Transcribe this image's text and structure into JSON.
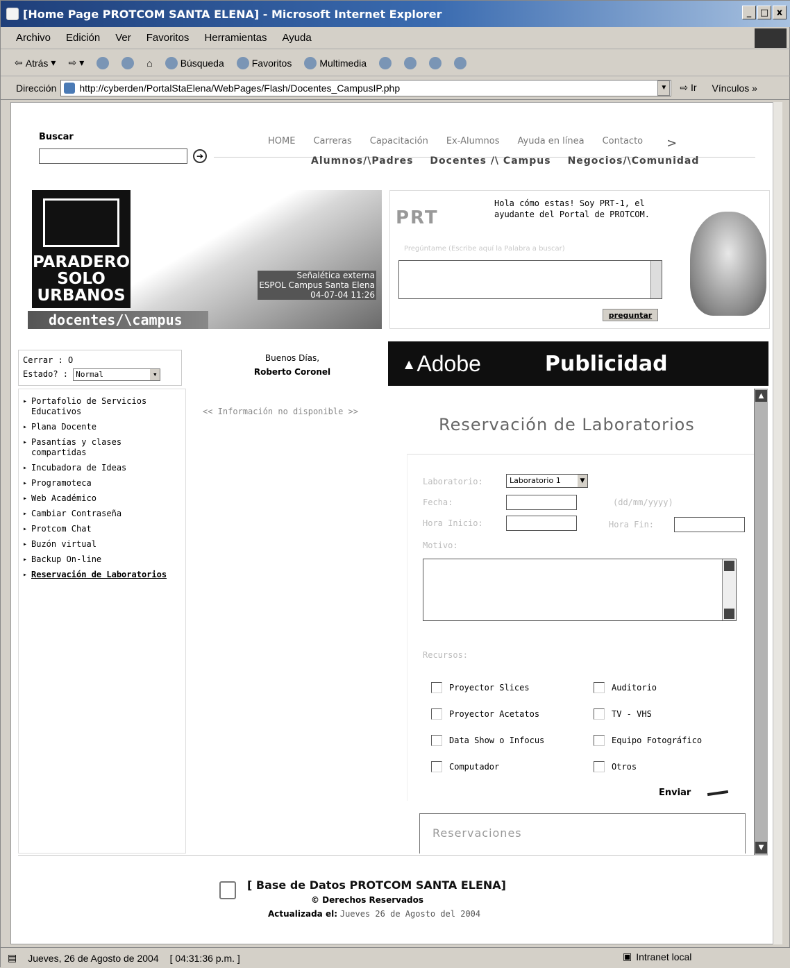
{
  "window": {
    "title": "[Home Page PROTCOM SANTA ELENA] - Microsoft Internet Explorer",
    "min": "_",
    "max": "□",
    "close": "x"
  },
  "menubar": [
    "Archivo",
    "Edición",
    "Ver",
    "Favoritos",
    "Herramientas",
    "Ayuda"
  ],
  "toolbar": {
    "back": "Atrás",
    "search": "Búsqueda",
    "favorites": "Favoritos",
    "multimedia": "Multimedia"
  },
  "address": {
    "label": "Dirección",
    "url": "http://cyberden/PortalStaElena/WebPages/Flash/Docentes_CampusIP.php",
    "go": "Ir",
    "links": "Vínculos »"
  },
  "header": {
    "search_label": "Buscar",
    "go_symbol": "➔",
    "topnav": [
      "HOME",
      "Carreras",
      "Capacitación",
      "Ex-Alumnos",
      "Ayuda en línea",
      "Contacto"
    ],
    "topnav_arrow": ">",
    "secnav": [
      "Alumnos/\\Padres",
      "Docentes /\\ Campus",
      "Negocios/\\Comunidad"
    ]
  },
  "banner": {
    "sign_lines": [
      "PARADERO",
      "SOLO",
      "URBANOS"
    ],
    "caption": [
      "Señalética externa",
      "ESPOL Campus Santa Elena",
      "04-07-04 11:26"
    ],
    "section": "docentes/\\campus"
  },
  "prt": {
    "logo": "PRT",
    "greeting": "Hola cómo estas! Soy PRT-1, el ayudante del Portal de PROTCOM.",
    "hint": "Pregúntame (Escribe aquí la Palabra a buscar)",
    "ask_button": "preguntar"
  },
  "status": {
    "close_label": "Cerrar :",
    "close_value": "O",
    "state_label": "Estado? :",
    "state_value": "Normal"
  },
  "greeting": {
    "salutation": "Buenos Días,",
    "name": "Roberto Coronel"
  },
  "ad": {
    "brand": "Adobe",
    "label": "Publicidad"
  },
  "sidemenu": [
    "Portafolio de Servicios Educativos",
    "Plana Docente",
    "Pasantías y clases compartidas",
    "Incubadora de Ideas",
    "Programoteca",
    "Web Académico",
    "Cambiar Contraseña",
    "Protcom Chat",
    "Buzón virtual",
    "Backup On-line",
    "Reservación de Laboratorios"
  ],
  "nodata": "<< Información no disponible >>",
  "reservation": {
    "title": "Reservación de Laboratorios",
    "lab_label": "Laboratorio:",
    "lab_value": "Laboratorio 1",
    "date_label": "Fecha:",
    "date_hint": "(dd/mm/yyyy)",
    "start_label": "Hora Inicio:",
    "end_label": "Hora Fin:",
    "reason_label": "Motivo:",
    "resources_label": "Recursos:",
    "resources": [
      "Proyector Slices",
      "Auditorio",
      "Proyector Acetatos",
      "TV - VHS",
      "Data Show o Infocus",
      "Equipo Fotográfico",
      "Computador",
      "Otros"
    ],
    "submit": "Enviar",
    "list_title": "Reservaciones"
  },
  "footer": {
    "title": "[ Base de Datos PROTCOM SANTA ELENA]",
    "rights": "© Derechos Reservados",
    "updated_label": "Actualizada el:",
    "updated_value": "Jueves 26 de Agosto del 2004"
  },
  "statusbar": {
    "date": "Jueves, 26 de Agosto de 2004",
    "time": "[ 04:31:36 p.m. ]",
    "zone": "Intranet local"
  }
}
